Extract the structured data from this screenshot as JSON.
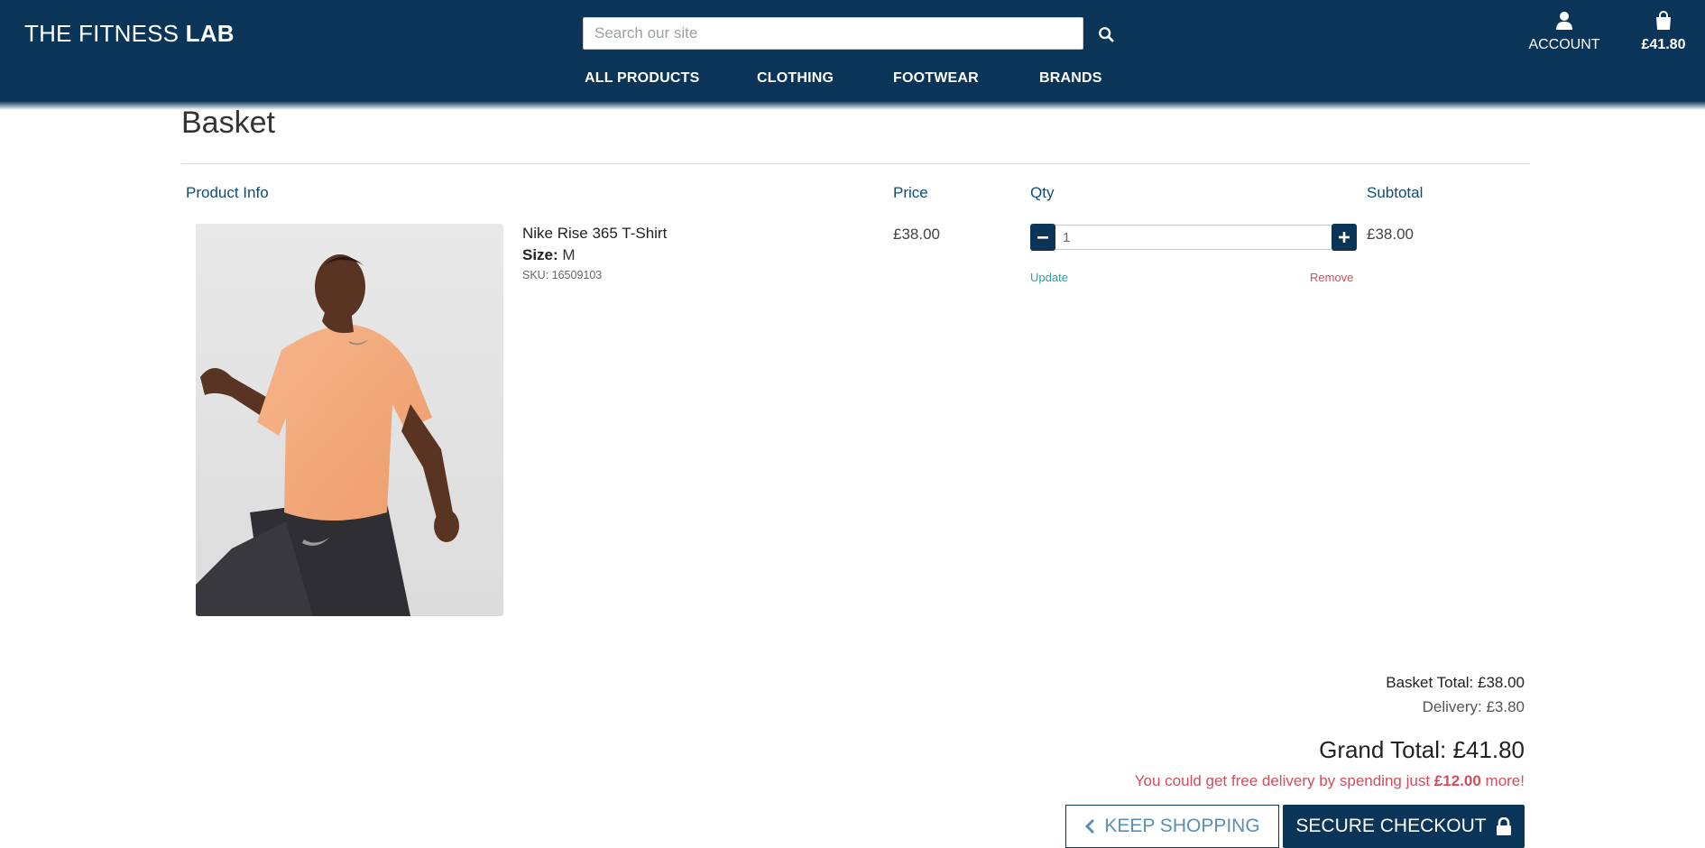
{
  "header": {
    "logo_regular": "THE FITNESS",
    "logo_bold": "LAB",
    "search_placeholder": "Search our site",
    "account_label": "ACCOUNT",
    "bag_total": "£41.80",
    "nav": [
      "ALL PRODUCTS",
      "CLOTHING",
      "FOOTWEAR",
      "BRANDS"
    ]
  },
  "page": {
    "title": "Basket"
  },
  "table": {
    "headers": {
      "product": "Product Info",
      "price": "Price",
      "qty": "Qty",
      "subtotal": "Subtotal"
    },
    "item": {
      "name": "Nike Rise 365 T-Shirt",
      "size_label": "Size:",
      "size": "M",
      "sku": "SKU: 16509103",
      "price": "£38.00",
      "qty": "1",
      "subtotal": "£38.00",
      "update_label": "Update",
      "remove_label": "Remove"
    }
  },
  "summary": {
    "basket_total": "Basket Total: £38.00",
    "delivery": "Delivery: £3.80",
    "grand_total": "Grand Total: £41.80",
    "free_prefix": "You could get free delivery by spending just",
    "free_amount": "£12.00",
    "free_suffix": "more!"
  },
  "buttons": {
    "keep_shopping": "KEEP SHOPPING",
    "secure_checkout": "SECURE CHECKOUT"
  },
  "colors": {
    "brand_navy": "#0a3558",
    "accent_blue": "#0a4d7a",
    "teal": "#2aa1a8",
    "alert_red": "#d24c5c"
  }
}
